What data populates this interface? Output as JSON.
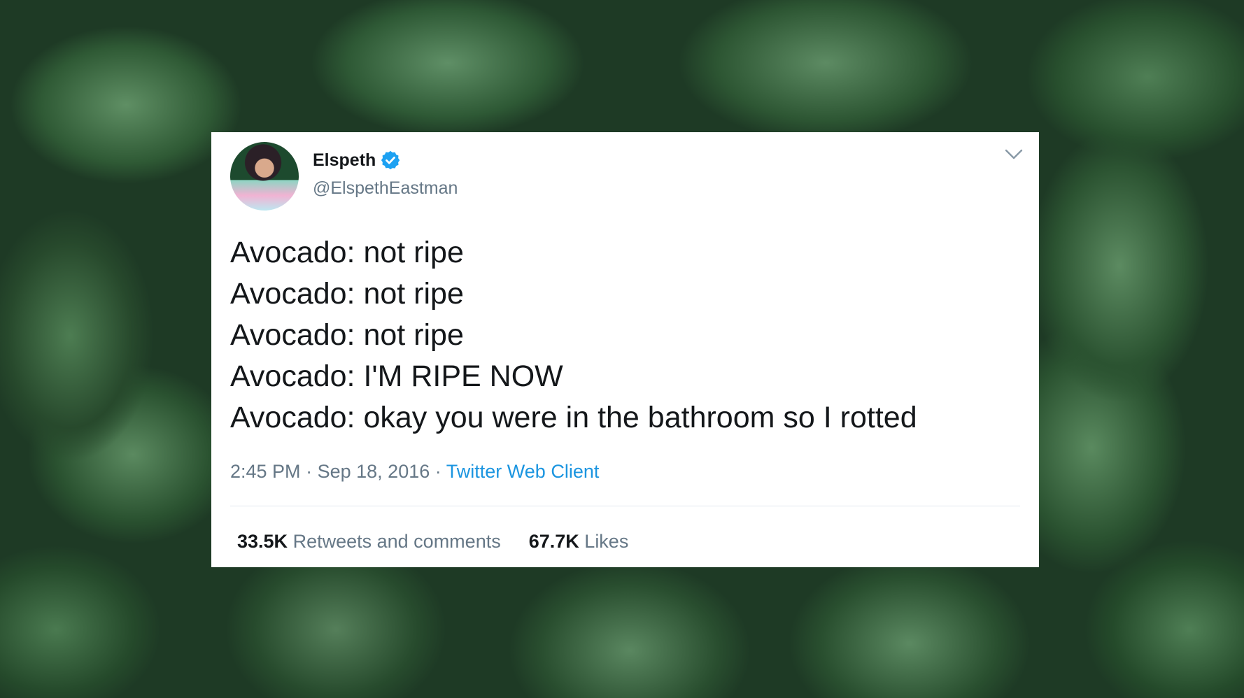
{
  "tweet": {
    "author_name": "Elspeth",
    "handle": "@ElspethEastman",
    "lines": [
      "Avocado: not ripe",
      "Avocado: not ripe",
      "Avocado: not ripe",
      "Avocado: I'M RIPE NOW",
      "Avocado: okay you were in the bathroom so I rotted"
    ],
    "time": "2:45 PM",
    "date": "Sep 18, 2016",
    "source": "Twitter Web Client",
    "separator": "·",
    "retweets_count": "33.5K",
    "retweets_label": "Retweets and comments",
    "likes_count": "67.7K",
    "likes_label": "Likes"
  },
  "icons": {
    "verified": "verified-badge-icon",
    "menu": "chevron-down-icon"
  },
  "colors": {
    "verified_blue": "#1da1f2",
    "link_blue": "#1b95e0",
    "secondary_text": "#657786",
    "primary_text": "#14171a"
  }
}
